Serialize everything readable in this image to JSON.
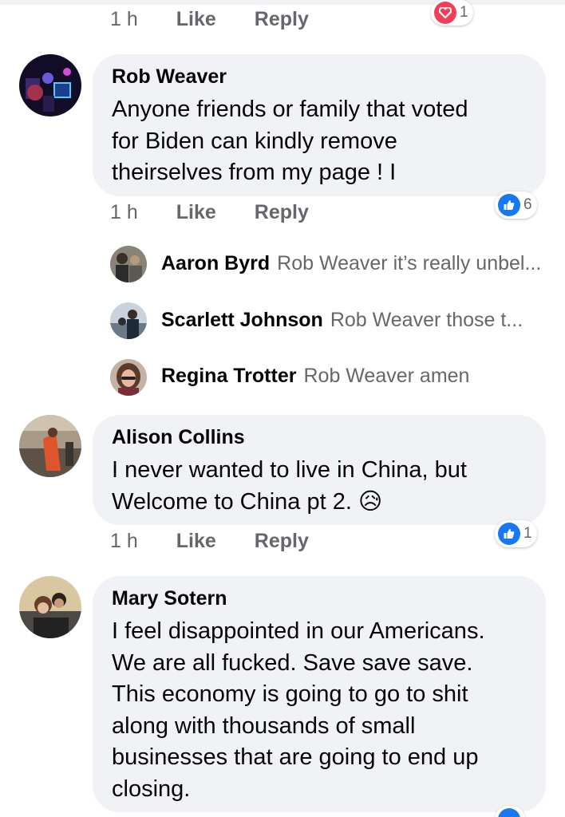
{
  "top_actions": {
    "time": "1 h",
    "like": "Like",
    "reply": "Reply",
    "reaction_count": "1"
  },
  "comments": [
    {
      "author": "Rob Weaver",
      "text": "Anyone friends or family that voted\nfor Biden can kindly remove\ntheirselves from my page ! I",
      "time": "1 h",
      "like": "Like",
      "reply": "Reply",
      "reaction_icon": "like-icon",
      "reaction_count": "6"
    },
    {
      "author": "Alison Collins",
      "text": "I never wanted to live in China, but\nWelcome to China pt 2.",
      "emoji": "😥",
      "time": "1 h",
      "like": "Like",
      "reply": "Reply",
      "reaction_icon": "like-icon",
      "reaction_count": "1"
    },
    {
      "author": "Mary Sotern",
      "text": "I feel disappointed in our Americans.\nWe are all fucked.  Save save save.\nThis economy is going to go to shit\nalong with thousands of small\nbusinesses that are going to end up\nclosing."
    }
  ],
  "replies": [
    {
      "author": "Aaron Byrd",
      "preview": "Rob Weaver it’s really unbel..."
    },
    {
      "author": "Scarlett Johnson",
      "preview": "Rob Weaver those  t..."
    },
    {
      "author": "Regina Trotter",
      "preview": "Rob Weaver amen"
    }
  ],
  "colors": {
    "bubble": "#f0f2f5",
    "meta_text": "#65676b",
    "like_blue": "#1877f2",
    "love_red": "#f33e58"
  }
}
